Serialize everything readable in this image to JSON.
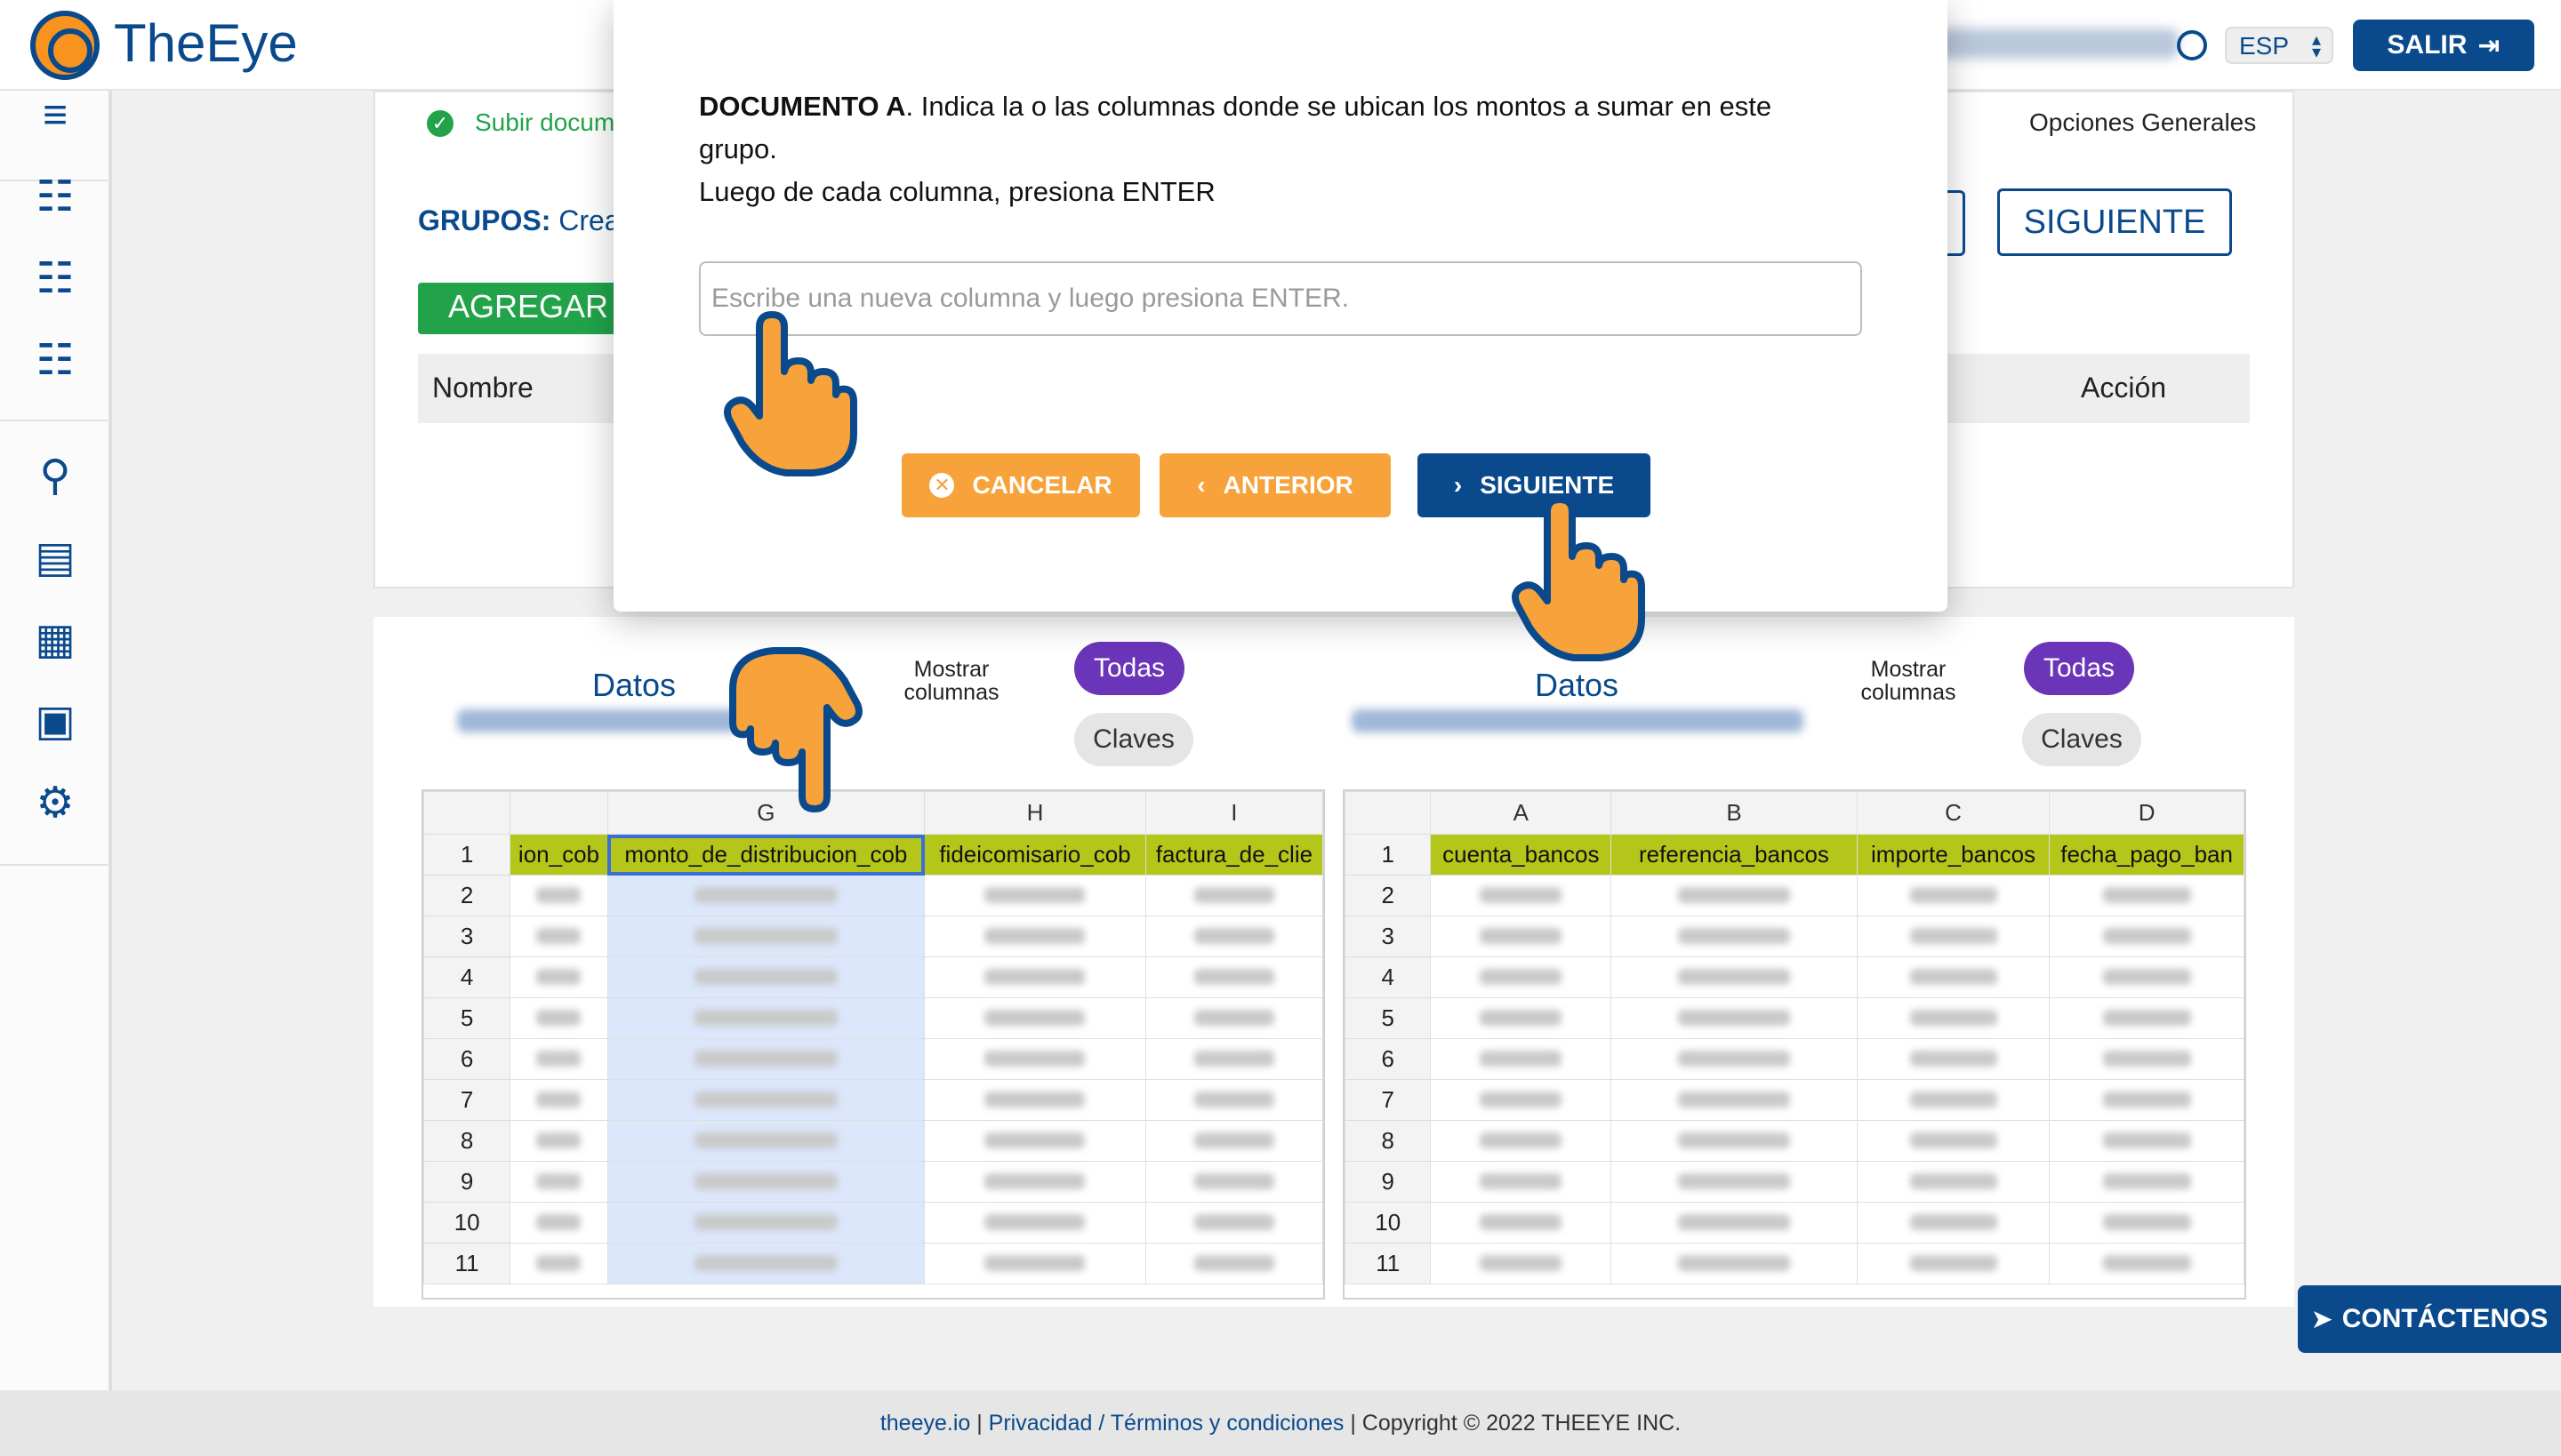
{
  "app": {
    "brand": "TheEye",
    "language": "ESP",
    "logout_label": "SALIR"
  },
  "background": {
    "step_label": "Subir docum",
    "general_options": "Opciones Generales",
    "groups_label": "GRUPOS:",
    "groups_rest": " Crea",
    "add_button": "AGREGAR",
    "next_button": "SIGUIENTE",
    "table_col_name": "Nombre",
    "table_col_action": "Acción"
  },
  "datasets": [
    {
      "title": "Datos",
      "show_columns": "Mostrar columnas",
      "filter_all": "Todas",
      "filter_keys": "Claves",
      "columns": [
        "",
        "G",
        "H",
        "I"
      ],
      "header_row": [
        "ion_cob",
        "monto_de_distribucion_cob",
        "fideicomisario_cob",
        "factura_de_clie"
      ],
      "rows": [
        "1",
        "2",
        "3",
        "4",
        "5",
        "6",
        "7",
        "8",
        "9",
        "10",
        "11"
      ]
    },
    {
      "title": "Datos",
      "show_columns": "Mostrar columnas",
      "filter_all": "Todas",
      "filter_keys": "Claves",
      "columns": [
        "A",
        "B",
        "C",
        "D"
      ],
      "header_row": [
        "cuenta_bancos",
        "referencia_bancos",
        "importe_bancos",
        "fecha_pago_ban"
      ],
      "rows": [
        "1",
        "2",
        "3",
        "4",
        "5",
        "6",
        "7",
        "8",
        "9",
        "10",
        "11"
      ]
    }
  ],
  "modal": {
    "doc_label": "DOCUMENTO A",
    "instruction": ". Indica la o las columnas donde se ubican los montos a sumar en este grupo.",
    "instruction2": "Luego de cada columna, presiona ENTER",
    "input_placeholder": "Escribe una nueva columna y luego presiona ENTER.",
    "input_value": "",
    "cancel_label": "CANCELAR",
    "prev_label": "ANTERIOR",
    "next_label": "SIGUIENTE"
  },
  "contact_label": "CONTÁCTENOS",
  "footer": {
    "site": "theeye.io",
    "sep1": " | ",
    "privacy": "Privacidad / Términos y condiciones",
    "copyright": " | Copyright © 2022 THEEYE INC."
  },
  "colors": {
    "brand_blue": "#0a4a8c",
    "orange": "#f7a23a",
    "green": "#22a34a",
    "purple": "#6a35b8",
    "header_lime": "#b5c61a"
  }
}
